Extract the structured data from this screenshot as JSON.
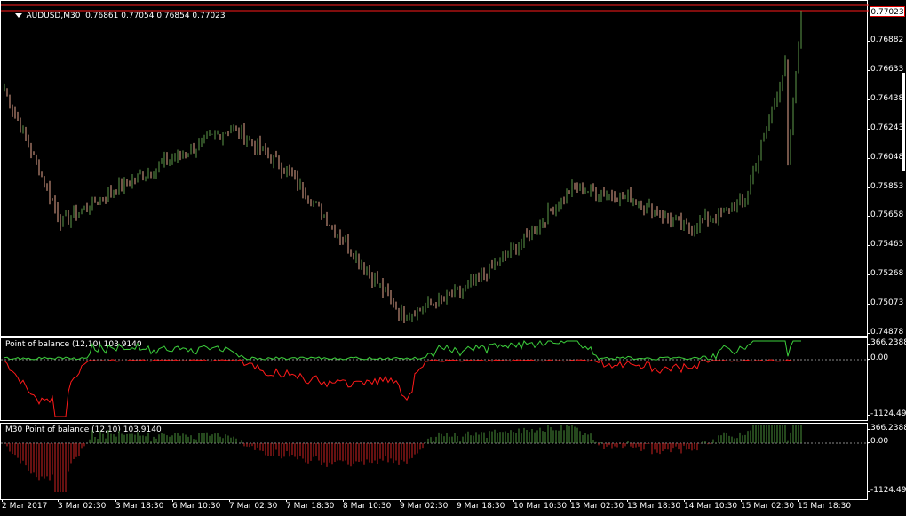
{
  "chart": {
    "symbol": "AUDUSD,M30",
    "ohlc": "0.76861 0.77054 0.76854 0.77023",
    "current_price": "0.77023"
  },
  "price_scale": [
    "0.76882",
    "0.76633",
    "0.76438",
    "0.76243",
    "0.76048",
    "0.75853",
    "0.75658",
    "0.75463",
    "0.75268",
    "0.75073",
    "0.74878"
  ],
  "indicator1": {
    "label": "Point of balance (12,10) 103.9140",
    "scale": [
      "366.2388",
      "0.00",
      "-1124.4900"
    ]
  },
  "indicator2": {
    "label": "M30 Point of balance (12,10) 103.9140",
    "scale": [
      "366.2388",
      "0.00",
      "-1124.4900"
    ]
  },
  "time_axis": [
    "2 Mar 2017",
    "3 Mar 02:30",
    "3 Mar 18:30",
    "6 Mar 10:30",
    "7 Mar 02:30",
    "7 Mar 18:30",
    "8 Mar 10:30",
    "9 Mar 02:30",
    "9 Mar 18:30",
    "10 Mar 10:30",
    "13 Mar 02:30",
    "13 Mar 18:30",
    "14 Mar 10:30",
    "15 Mar 02:30",
    "15 Mar 18:30"
  ],
  "colors": {
    "bull": "#5e9a4a",
    "bear": "#e8a98f",
    "red_line": "#ff1a1a",
    "green_line": "#3ccf3c",
    "hist_pos": "#4a8f3a",
    "hist_neg": "#cc2222"
  },
  "chart_data": {
    "type": "bar",
    "x": [
      "2 Mar 2017",
      "3 Mar 02:30",
      "3 Mar 18:30",
      "6 Mar 10:30",
      "7 Mar 02:30",
      "7 Mar 18:30",
      "8 Mar 10:30",
      "9 Mar 02:30",
      "9 Mar 18:30",
      "10 Mar 10:30",
      "13 Mar 02:30",
      "13 Mar 18:30",
      "14 Mar 10:30",
      "15 Mar 02:30",
      "15 Mar 18:30"
    ],
    "series": [
      {
        "values": [
          0.765,
          0.7562,
          0.7585,
          0.7605,
          0.7625,
          0.7595,
          0.7548,
          0.75,
          0.7515,
          0.7545,
          0.7585,
          0.7578,
          0.7558,
          0.7575,
          0.7702
        ]
      }
    ],
    "ylim": [
      0.74878,
      0.77023
    ]
  }
}
